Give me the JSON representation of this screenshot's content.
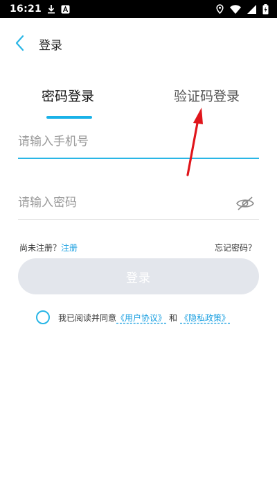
{
  "status_bar": {
    "time": "16:21",
    "icons": [
      "download-icon",
      "app-notification-icon",
      "location-icon",
      "wifi-icon",
      "signal-icon",
      "battery-charging-icon"
    ]
  },
  "header": {
    "title": "登录",
    "back_icon": "chevron-left-icon"
  },
  "tabs": [
    {
      "label": "密码登录",
      "active": true
    },
    {
      "label": "验证码登录",
      "active": false
    }
  ],
  "form": {
    "phone_placeholder": "请输入手机号",
    "phone_value": "",
    "password_placeholder": "请输入密码",
    "password_value": "",
    "password_toggle_icon": "eye-off-icon"
  },
  "links": {
    "no_account": "尚未注册？",
    "register": "注册",
    "forgot": "忘记密码？"
  },
  "login_button": {
    "label": "登录",
    "enabled": false
  },
  "agreement": {
    "prefix": "我已阅读并同意",
    "user_agreement": "《用户协议》",
    "and": "和",
    "privacy_policy": "《隐私政策》",
    "checked": false
  },
  "colors": {
    "accent": "#1ab2e8",
    "link": "#1a9fe0",
    "button_disabled": "#e3e6ec",
    "annotation_arrow": "#e0151b"
  }
}
